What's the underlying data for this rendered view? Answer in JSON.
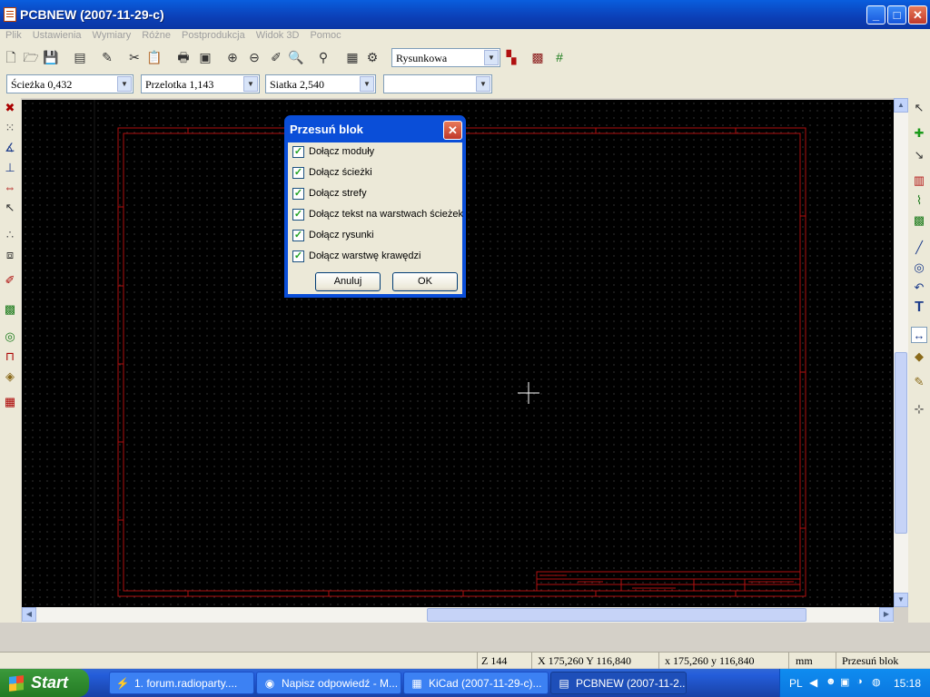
{
  "window": {
    "title": "PCBNEW (2007-11-29-c)",
    "minimize": "_",
    "maximize": "□",
    "close": "✕"
  },
  "menu": [
    "Plik",
    "Ustawienia",
    "Wymiary",
    "Różne",
    "Postprodukcja",
    "Widok 3D",
    "Pomoc"
  ],
  "toolbar": {
    "icons": [
      "new-file-icon",
      "open-folder-icon",
      "save-icon",
      "page-settings-icon",
      "load-module-icon",
      "cut-icon",
      "paste-icon",
      "print-icon",
      "plot-icon",
      "zoom-in-icon",
      "zoom-out-icon",
      "redraw-icon",
      "zoom-auto-icon",
      "find-icon",
      "netlist-icon",
      "drc-icon"
    ],
    "layer_select": "Rysunkowa",
    "right_icons": [
      "layer-pair-icon",
      "mode-module-icon",
      "mode-track-icon"
    ]
  },
  "toolbar2": {
    "track_width": "Ścieżka 0,432",
    "via_size": "Przelotka 1,143",
    "grid_size": "Siatka 2,540",
    "zoom_select": ""
  },
  "left_tools": [
    "drc-off-icon",
    "grid-toggle-icon",
    "polar-coords-icon",
    "units-mm-icon",
    "units-inch-icon",
    "cursor-shape-icon",
    "show-ratsnest-icon",
    "show-module-ratsnest-icon",
    "auto-delete-track-icon",
    "show-zones-icon",
    "pads-sketch-icon",
    "tracks-sketch-icon",
    "high-contrast-icon",
    "microwave-icon"
  ],
  "right_tools": [
    "select-arrow-icon",
    "highlight-net-icon",
    "local-ratsnest-icon",
    "add-module-icon",
    "add-track-icon",
    "add-zone-icon",
    "add-line-icon",
    "add-circle-icon",
    "add-arc-icon",
    "add-text-icon",
    "add-dimension-icon",
    "add-mire-icon",
    "delete-icon",
    "set-origin-icon"
  ],
  "dialog": {
    "title": "Przesuń blok",
    "options": [
      {
        "label": "Dołącz moduły",
        "checked": true
      },
      {
        "label": "Dołącz ścieżki",
        "checked": true
      },
      {
        "label": "Dołącz strefy",
        "checked": true
      },
      {
        "label": "Dołącz tekst na warstwach ścieżek",
        "checked": true
      },
      {
        "label": "Dołącz rysunki",
        "checked": true
      },
      {
        "label": "Dołącz warstwę krawędzi",
        "checked": true
      }
    ],
    "cancel": "Anuluj",
    "ok": "OK"
  },
  "status": {
    "zoom": "Z 144",
    "abs_coords": "X 175,260  Y 116,840",
    "rel_coords": "x 175,260  y 116,840",
    "units": "mm",
    "mode": "Przesuń blok"
  },
  "taskbar": {
    "start": "Start",
    "tasks": [
      {
        "label": "1. forum.radioparty....",
        "icon": "explorer-icon",
        "active": false
      },
      {
        "label": "Napisz odpowiedź - M...",
        "icon": "firefox-icon",
        "active": false
      },
      {
        "label": "KiCad (2007-11-29-c)...",
        "icon": "kicad-icon",
        "active": false
      },
      {
        "label": "PCBNEW (2007-11-2...",
        "icon": "pcbnew-icon",
        "active": true
      }
    ],
    "language": "PL",
    "clock": "15:18"
  },
  "colors": {
    "canvas": "#000000",
    "sheet_frame": "#b01010",
    "grid": "#3a3a3a",
    "accent": "#0a4ed8"
  }
}
